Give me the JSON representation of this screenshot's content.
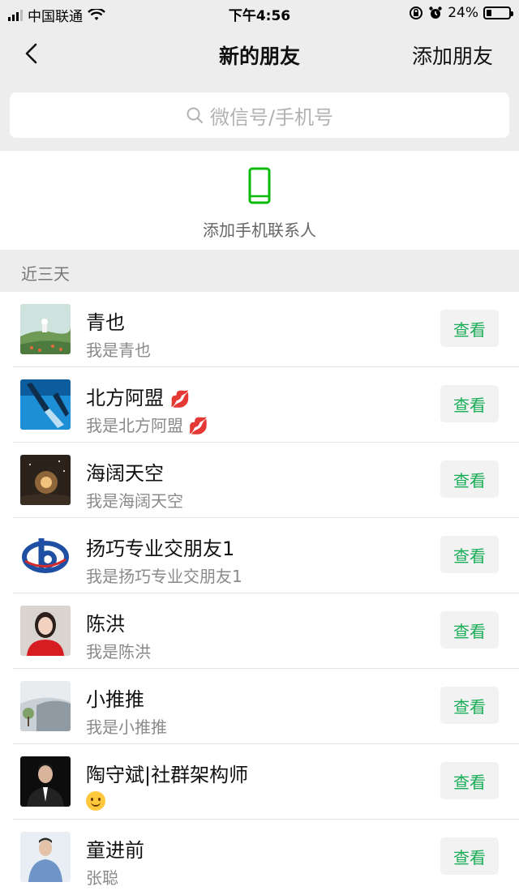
{
  "status_bar": {
    "carrier": "中国联通",
    "time": "下午4:56",
    "battery_percent": "24%",
    "battery_level": 0.24
  },
  "nav": {
    "title": "新的朋友",
    "add_friend": "添加朋友"
  },
  "search": {
    "placeholder": "微信号/手机号"
  },
  "add_phone_contacts": {
    "label": "添加手机联系人"
  },
  "section": {
    "title": "近三天"
  },
  "view_label": "查看",
  "friends": [
    {
      "name": "青也",
      "message": "我是青也"
    },
    {
      "name": "北方阿盟",
      "message": "我是北方阿盟"
    },
    {
      "name": "海阔天空",
      "message": "我是海阔天空"
    },
    {
      "name": "扬巧专业交朋友1",
      "message": "我是扬巧专业交朋友1"
    },
    {
      "name": "陈洪",
      "message": "我是陈洪"
    },
    {
      "name": "小推推",
      "message": "我是小推推"
    },
    {
      "name": "陶守斌|社群架构师",
      "message": ""
    },
    {
      "name": "童进前",
      "message": "张聪"
    }
  ],
  "colors": {
    "accent_green": "#1aad57",
    "background": "#ededed"
  }
}
